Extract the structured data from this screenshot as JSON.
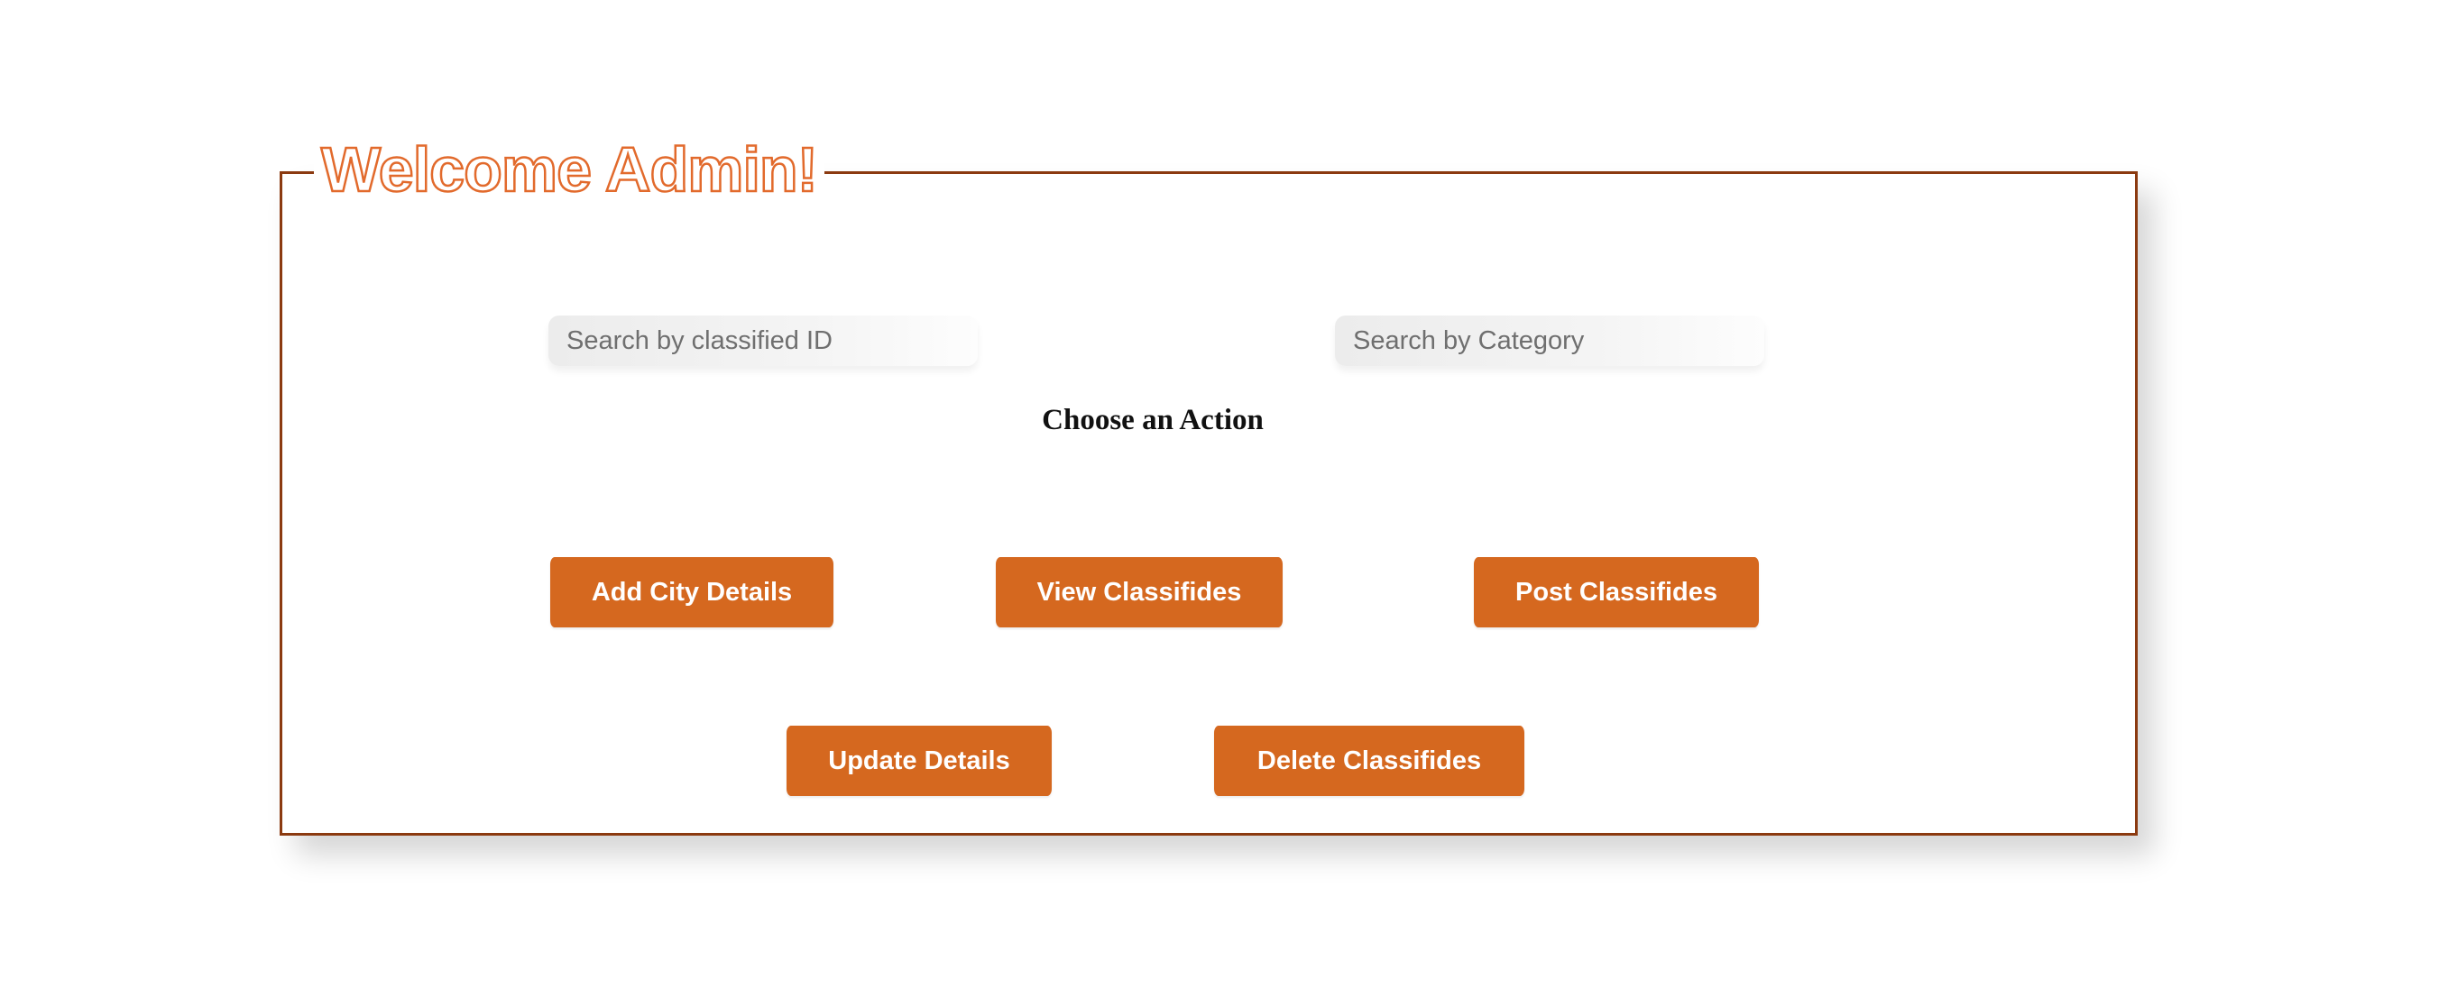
{
  "panel": {
    "legend": "Welcome Admin!"
  },
  "search": {
    "classified_id_placeholder": "Search by classified ID",
    "category_placeholder": "Search by Category"
  },
  "heading": "Choose an Action",
  "actions": {
    "add_city": "Add City Details",
    "view": "View Classifides",
    "post": "Post Classifides",
    "update": "Update Details",
    "delete": "Delete Classifides"
  },
  "colors": {
    "accent": "#d5681f",
    "border": "#8b3a10",
    "legend_outline": "#e26a2c"
  }
}
